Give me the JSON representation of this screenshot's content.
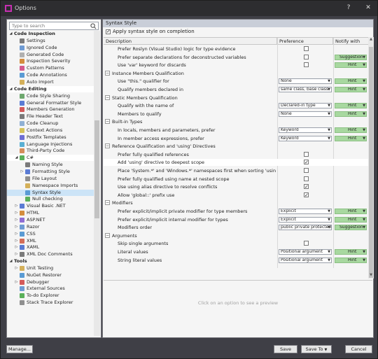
{
  "window": {
    "title": "Options"
  },
  "search": {
    "placeholder": "Type to search"
  },
  "tree": [
    {
      "label": "Code Inspection",
      "level": 0,
      "exp": "◢",
      "head": true,
      "color": ""
    },
    {
      "label": "Settings",
      "level": 1,
      "color": "#7a7a7a",
      "icon": "gear-icon"
    },
    {
      "label": "Ignored Code",
      "level": 1,
      "color": "#6e9bd4",
      "icon": "ignored-code-icon"
    },
    {
      "label": "Generated Code",
      "level": 1,
      "color": "#b0b0b0",
      "icon": "generated-code-icon"
    },
    {
      "label": "Inspection Severity",
      "level": 1,
      "color": "#d48d3e",
      "icon": "severity-icon"
    },
    {
      "label": "Custom Patterns",
      "level": 1,
      "color": "#d45a8f",
      "icon": "patterns-icon"
    },
    {
      "label": "Code Annotations",
      "level": 1,
      "color": "#5a9bd4",
      "icon": "annotations-icon"
    },
    {
      "label": "Auto Import",
      "level": 1,
      "color": "#d4b05a",
      "icon": "auto-import-icon"
    },
    {
      "label": "Code Editing",
      "level": 0,
      "exp": "◢",
      "head": true,
      "sel": true,
      "color": ""
    },
    {
      "label": "Code Style Sharing",
      "level": 1,
      "color": "#6ea86e",
      "icon": "style-sharing-icon"
    },
    {
      "label": "General Formatter Style",
      "level": 1,
      "color": "#5a7bd4",
      "icon": "formatter-icon"
    },
    {
      "label": "Members Generation",
      "level": 1,
      "color": "#d45a5a",
      "icon": "members-icon"
    },
    {
      "label": "File Header Text",
      "level": 1,
      "color": "#7a7a7a",
      "icon": "file-header-icon"
    },
    {
      "label": "Code Cleanup",
      "level": 1,
      "color": "#8fb0d4",
      "icon": "cleanup-icon"
    },
    {
      "label": "Context Actions",
      "level": 1,
      "color": "#d4c25a",
      "icon": "context-actions-icon"
    },
    {
      "label": "Postfix Templates",
      "level": 1,
      "color": "#6e6ed4",
      "icon": "postfix-icon"
    },
    {
      "label": "Language Injections",
      "level": 1,
      "color": "#5ab0d4",
      "icon": "injections-icon"
    },
    {
      "label": "Third-Party Code",
      "level": 1,
      "color": "#d48d5a",
      "icon": "third-party-icon"
    },
    {
      "label": "C#",
      "level": 1,
      "exp": "◢",
      "sel": true,
      "color": "#5ab05a",
      "icon": "csharp-icon"
    },
    {
      "label": "Naming Style",
      "level": 2,
      "color": "#7a7a7a",
      "icon": "naming-icon"
    },
    {
      "label": "Formatting Style",
      "level": 2,
      "exp": "▷",
      "color": "#5a7bd4",
      "icon": "formatting-icon"
    },
    {
      "label": "File Layout",
      "level": 2,
      "color": "#8f8f8f",
      "icon": "file-layout-icon"
    },
    {
      "label": "Namespace Imports",
      "level": 2,
      "color": "#d4b05a",
      "icon": "namespace-icon"
    },
    {
      "label": "Syntax Style",
      "level": 2,
      "sel2": true,
      "color": "#5a9bd4",
      "icon": "syntax-style-icon"
    },
    {
      "label": "Null checking",
      "level": 2,
      "color": "#5ab05a",
      "icon": "null-check-icon"
    },
    {
      "label": "Visual Basic .NET",
      "level": 1,
      "exp": "▷",
      "color": "#5a7bd4",
      "icon": "vb-icon"
    },
    {
      "label": "HTML",
      "level": 1,
      "exp": "▷",
      "color": "#d48d3e",
      "icon": "html-icon"
    },
    {
      "label": "ASP.NET",
      "level": 1,
      "exp": "▷",
      "color": "#8f6ed4",
      "icon": "aspnet-icon"
    },
    {
      "label": "Razor",
      "level": 1,
      "exp": "▷",
      "color": "#6e9bd4",
      "icon": "razor-icon"
    },
    {
      "label": "CSS",
      "level": 1,
      "exp": "▷",
      "color": "#5a9bd4",
      "icon": "css-icon"
    },
    {
      "label": "XML",
      "level": 1,
      "exp": "▷",
      "color": "#d46e5a",
      "icon": "xml-icon"
    },
    {
      "label": "XAML",
      "level": 1,
      "exp": "▷",
      "color": "#5a7bd4",
      "icon": "xaml-icon"
    },
    {
      "label": "XML Doc Comments",
      "level": 1,
      "exp": "▷",
      "color": "#7a7a7a",
      "icon": "xmldoc-icon"
    },
    {
      "label": "Tools",
      "level": 0,
      "exp": "◢",
      "head": true,
      "color": ""
    },
    {
      "label": "Unit Testing",
      "level": 1,
      "exp": "▷",
      "color": "#d4b05a",
      "icon": "unit-test-icon"
    },
    {
      "label": "NuGet Restorer",
      "level": 1,
      "color": "#5a9bd4",
      "icon": "nuget-icon"
    },
    {
      "label": "Debugger",
      "level": 1,
      "exp": "▷",
      "color": "#d45a5a",
      "icon": "debugger-icon"
    },
    {
      "label": "External Sources",
      "level": 1,
      "color": "#6e9bd4",
      "icon": "external-sources-icon"
    },
    {
      "label": "To-do Explorer",
      "level": 1,
      "color": "#5ab05a",
      "icon": "todo-icon"
    },
    {
      "label": "Stack Trace Explorer",
      "level": 1,
      "color": "#8f8f8f",
      "icon": "stack-trace-icon"
    }
  ],
  "right": {
    "header": "Syntax Style",
    "apply_label": "Apply syntax style on completion",
    "columns": {
      "description": "Description",
      "preference": "Preference",
      "notify": "Notify with"
    },
    "preview_message": "Click on an option to see a preview"
  },
  "rows": [
    {
      "type": "item",
      "text": "Prefer Roslyn (Visual Studio) logic for type evidence",
      "pref": {
        "kind": "checkbox",
        "checked": false
      }
    },
    {
      "type": "item",
      "text": "Prefer separate declarations for deconstructed variables",
      "pref": {
        "kind": "checkbox",
        "checked": false
      },
      "notify": "Suggestion"
    },
    {
      "type": "item",
      "text": "Use 'var' keyword for discards",
      "pref": {
        "kind": "checkbox",
        "checked": false
      },
      "notify": "Hint"
    },
    {
      "type": "section",
      "text": "Instance Members Qualification"
    },
    {
      "type": "item",
      "text": "Use \"this.\" qualifier for",
      "pref": {
        "kind": "dropdown",
        "value": "None"
      },
      "notify": "Hint"
    },
    {
      "type": "item",
      "text": "Qualify members declared in",
      "pref": {
        "kind": "dropdown",
        "value": "same class, base class"
      },
      "notify": "Hint"
    },
    {
      "type": "section",
      "text": "Static Members Qualification"
    },
    {
      "type": "item",
      "text": "Qualify with the name of",
      "pref": {
        "kind": "dropdown",
        "value": "Declared-in type"
      },
      "notify": "Hint"
    },
    {
      "type": "item",
      "text": "Members to qualify",
      "pref": {
        "kind": "dropdown",
        "value": "None"
      },
      "notify": "Hint"
    },
    {
      "type": "section",
      "text": "Built-in Types"
    },
    {
      "type": "item",
      "text": "In locals, members and parameters, prefer",
      "pref": {
        "kind": "dropdown",
        "value": "Keyword"
      },
      "notify": "Hint"
    },
    {
      "type": "item",
      "text": "In member access expressions, prefer",
      "pref": {
        "kind": "dropdown",
        "value": "Keyword"
      },
      "notify": "Hint"
    },
    {
      "type": "section",
      "text": "Reference Qualification and 'using' Directives"
    },
    {
      "type": "item",
      "text": "Prefer fully qualified references",
      "pref": {
        "kind": "checkbox",
        "checked": false
      }
    },
    {
      "type": "item",
      "text": "Add 'using' directive to deepest scope",
      "pref": {
        "kind": "checkbox",
        "checked": true
      },
      "sel": true
    },
    {
      "type": "item",
      "text": "Place 'System.*' and 'Windows.*' namespaces first when sorting 'using' directives",
      "pref": {
        "kind": "checkbox",
        "checked": false
      }
    },
    {
      "type": "item",
      "text": "Prefer fully qualified using name at nested scope",
      "pref": {
        "kind": "checkbox",
        "checked": false
      }
    },
    {
      "type": "item",
      "text": "Use using alias directive to resolve conflicts",
      "pref": {
        "kind": "checkbox",
        "checked": true
      }
    },
    {
      "type": "item",
      "text": "Allow 'global::' prefix use",
      "pref": {
        "kind": "checkbox",
        "checked": true
      }
    },
    {
      "type": "section",
      "text": "Modifiers"
    },
    {
      "type": "item",
      "text": "Prefer explicit/implicit private modifier for type members",
      "pref": {
        "kind": "dropdown",
        "value": "Explicit"
      },
      "notify": "Hint"
    },
    {
      "type": "item",
      "text": "Prefer explicit/implicit internal modifier for types",
      "pref": {
        "kind": "dropdown",
        "value": "Explicit"
      },
      "notify": "Hint"
    },
    {
      "type": "item",
      "text": "Modifiers order",
      "pref": {
        "kind": "dropdown",
        "value": "public private protected"
      },
      "notify": "Suggestion"
    },
    {
      "type": "section",
      "text": "Arguments"
    },
    {
      "type": "item",
      "text": "Skip single arguments",
      "pref": {
        "kind": "checkbox",
        "checked": false
      }
    },
    {
      "type": "item",
      "text": "Literal values",
      "pref": {
        "kind": "dropdown",
        "value": "Positional argument"
      },
      "notify": "Hint"
    },
    {
      "type": "item",
      "text": "String literal values",
      "pref": {
        "kind": "dropdown",
        "value": "Positional argument"
      },
      "notify": "Hint"
    }
  ],
  "footer": {
    "manage": "Manage...",
    "save": "Save",
    "save_to": "Save To",
    "cancel": "Cancel"
  },
  "colors": {
    "hint_green": "#a8d8a0",
    "selected_row": "#ffffff",
    "tree_selected": "#cce4f7"
  }
}
